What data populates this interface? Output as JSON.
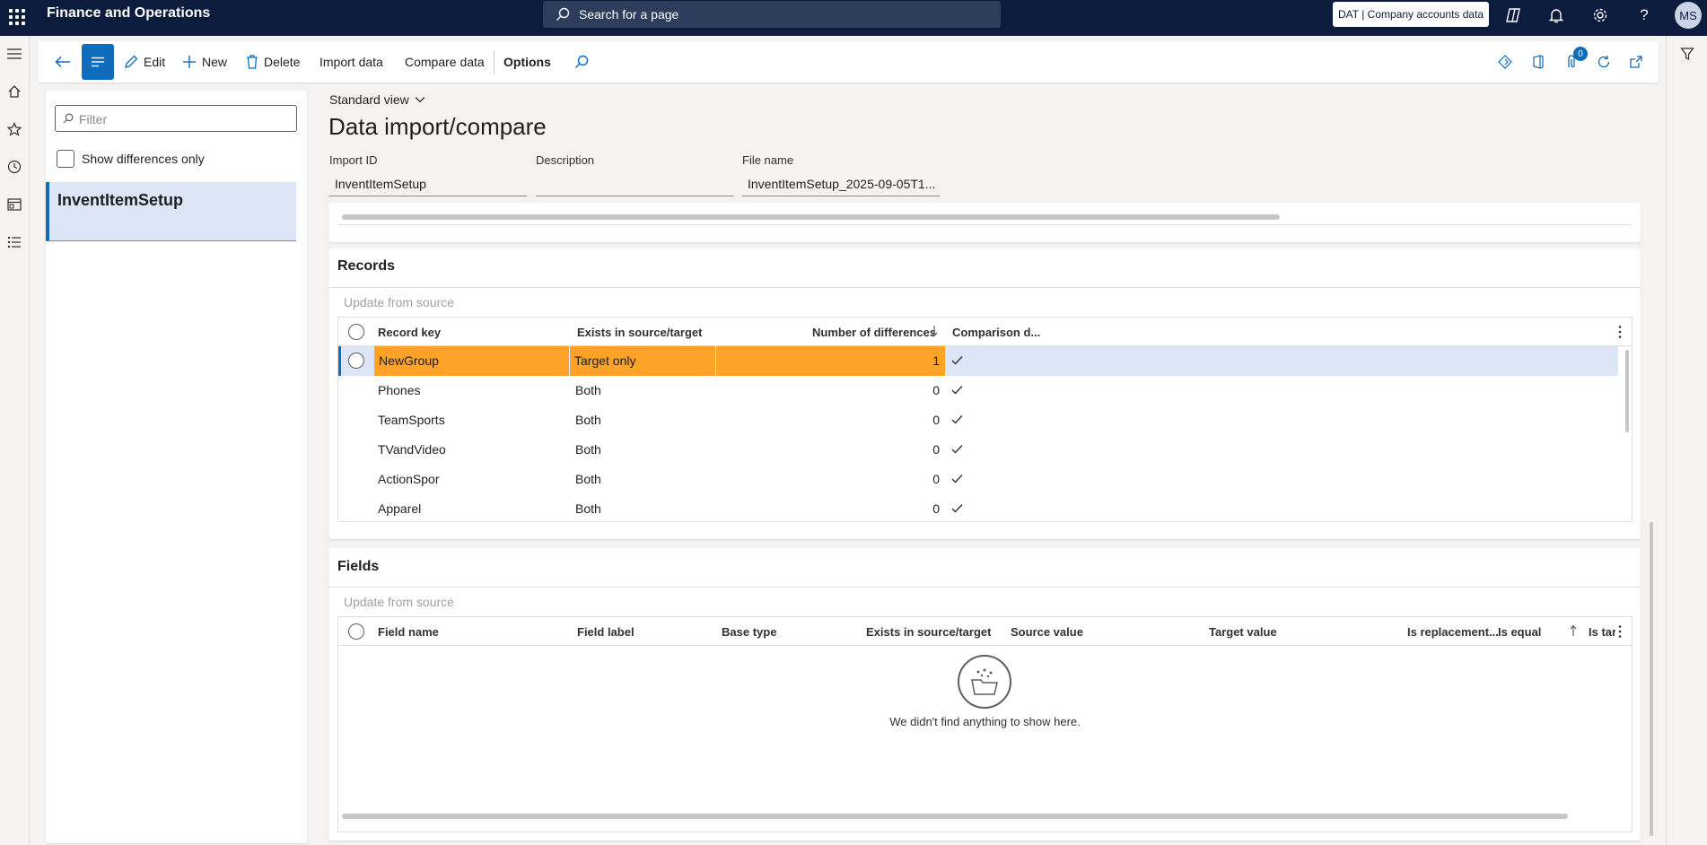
{
  "topbar": {
    "app_title": "Finance and Operations",
    "search_placeholder": "Search for a page",
    "company": "DAT | Company accounts data",
    "avatar_initials": "MS",
    "icons": [
      "app-launcher-icon",
      "copilot-icon",
      "bell-icon",
      "gear-icon",
      "help-icon"
    ]
  },
  "actions": {
    "edit": "Edit",
    "new": "New",
    "delete": "Delete",
    "import_data": "Import data",
    "compare_data": "Compare data",
    "options": "Options",
    "notifications_count": "0"
  },
  "list_pane": {
    "filter_placeholder": "Filter",
    "show_differences_label": "Show differences only",
    "show_differences_checked": false,
    "items": [
      {
        "label": "InventItemSetup",
        "selected": true
      }
    ]
  },
  "form": {
    "view_selector": "Standard view",
    "title": "Data import/compare",
    "fields": [
      {
        "label": "Import ID",
        "value": "InventItemSetup"
      },
      {
        "label": "Description",
        "value": ""
      },
      {
        "label": "File name",
        "value": "InventItemSetup_2025-09-05T1..."
      }
    ]
  },
  "records": {
    "title": "Records",
    "action": "Update from source",
    "columns": [
      "Record key",
      "Exists in source/target",
      "Number of differences",
      "Comparison d..."
    ],
    "sort_column": "Number of differences",
    "sort_direction": "descending",
    "rows": [
      {
        "key": "NewGroup",
        "exists": "Target only",
        "diffs": "1",
        "compared": true,
        "selected": true
      },
      {
        "key": "Phones",
        "exists": "Both",
        "diffs": "0",
        "compared": true,
        "selected": false
      },
      {
        "key": "TeamSports",
        "exists": "Both",
        "diffs": "0",
        "compared": true,
        "selected": false
      },
      {
        "key": "TVandVideo",
        "exists": "Both",
        "diffs": "0",
        "compared": true,
        "selected": false
      },
      {
        "key": "ActionSpor",
        "exists": "Both",
        "diffs": "0",
        "compared": true,
        "selected": false
      },
      {
        "key": "Apparel",
        "exists": "Both",
        "diffs": "0",
        "compared": true,
        "selected": false
      }
    ]
  },
  "fields_grid": {
    "title": "Fields",
    "action": "Update from source",
    "columns": [
      "Field name",
      "Field label",
      "Base type",
      "Exists in source/target",
      "Source value",
      "Target value",
      "Is replacement...",
      "Is equal",
      "Is targ"
    ],
    "empty_message": "We didn't find anything to show here."
  },
  "colors": {
    "nav_bar": "#0b1c3d",
    "accent": "#0f6cbd",
    "selected_row": "#dce6f7",
    "highlight": "#ffa228"
  }
}
